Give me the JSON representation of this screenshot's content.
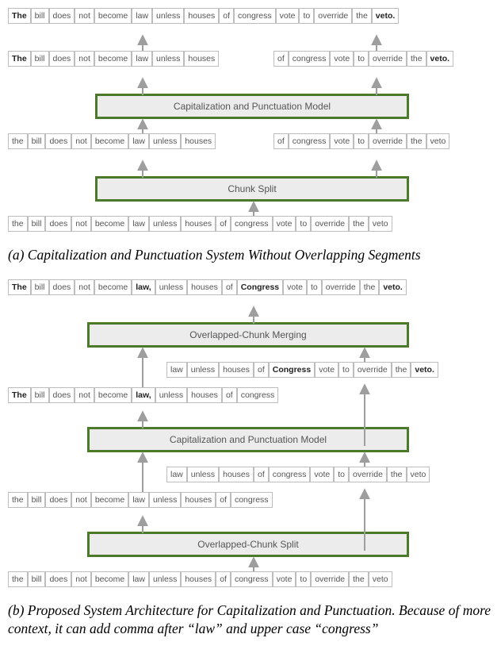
{
  "fig_a": {
    "caption": "(a) Capitalization and Punctuation System Without Overlapping Segments",
    "rows": {
      "top_output": [
        "The",
        "bill",
        "does",
        "not",
        "become",
        "law",
        "unless",
        "houses",
        "of",
        "congress",
        "vote",
        "to",
        "override",
        "the",
        "veto."
      ],
      "split_left": [
        "The",
        "bill",
        "does",
        "not",
        "become",
        "law",
        "unless",
        "houses"
      ],
      "split_right": [
        "of",
        "congress",
        "vote",
        "to",
        "override",
        "the",
        "veto."
      ],
      "model_label": "Capitalization and Punctuation Model",
      "pre_left": [
        "the",
        "bill",
        "does",
        "not",
        "become",
        "law",
        "unless",
        "houses"
      ],
      "pre_right": [
        "of",
        "congress",
        "vote",
        "to",
        "override",
        "the",
        "veto"
      ],
      "chunk_label": "Chunk Split",
      "input": [
        "the",
        "bill",
        "does",
        "not",
        "become",
        "law",
        "unless",
        "houses",
        "of",
        "congress",
        "vote",
        "to",
        "override",
        "the",
        "veto"
      ]
    }
  },
  "fig_b": {
    "caption": "(b) Proposed System Architecture for Capitalization and Punctuation. Because of more context, it can add comma after “law” and upper case “congress”",
    "rows": {
      "final_output": [
        "The",
        "bill",
        "does",
        "not",
        "become",
        "law,",
        "unless",
        "houses",
        "of",
        "Congress",
        "vote",
        "to",
        "override",
        "the",
        "veto."
      ],
      "merge_label": "Overlapped-Chunk Merging",
      "post_right": [
        "law",
        "unless",
        "houses",
        "of",
        "Congress",
        "vote",
        "to",
        "override",
        "the",
        "veto."
      ],
      "post_left": [
        "The",
        "bill",
        "does",
        "not",
        "become",
        "law,",
        "unless",
        "houses",
        "of",
        "congress"
      ],
      "model_label": "Capitalization and Punctuation Model",
      "pre_right": [
        "law",
        "unless",
        "houses",
        "of",
        "congress",
        "vote",
        "to",
        "override",
        "the",
        "veto"
      ],
      "pre_left": [
        "the",
        "bill",
        "does",
        "not",
        "become",
        "law",
        "unless",
        "houses",
        "of",
        "congress"
      ],
      "split_label": "Overlapped-Chunk Split",
      "input": [
        "the",
        "bill",
        "does",
        "not",
        "become",
        "law",
        "unless",
        "houses",
        "of",
        "congress",
        "vote",
        "to",
        "override",
        "the",
        "veto"
      ]
    }
  },
  "bold_tokens": [
    "The",
    "veto.",
    "law,",
    "Congress"
  ]
}
